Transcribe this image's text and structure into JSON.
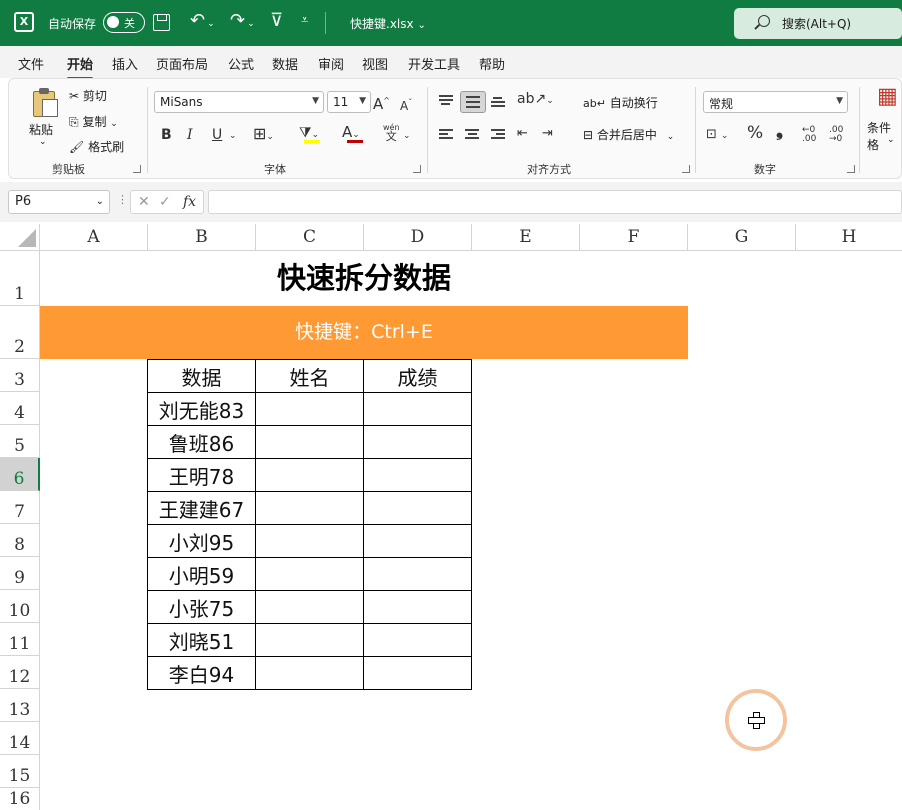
{
  "titlebar": {
    "logo": "X",
    "autosave_label": "自动保存",
    "autosave_state": "关",
    "filename": "快捷键.xlsx",
    "filename_caret": "⌄",
    "search_placeholder": "搜索(Alt+Q)"
  },
  "menu": {
    "tabs": [
      "文件",
      "开始",
      "插入",
      "页面布局",
      "公式",
      "数据",
      "审阅",
      "视图",
      "开发工具",
      "帮助"
    ],
    "active": "开始"
  },
  "ribbon": {
    "clipboard": {
      "paste": "粘贴",
      "cut": "剪切",
      "copy": "复制",
      "format_painter": "格式刷",
      "label": "剪贴板"
    },
    "font": {
      "name": "MiSans",
      "size": "11",
      "grow": "A",
      "shrink": "A",
      "bold": "B",
      "italic": "I",
      "underline": "U",
      "font_color_glyph": "A",
      "phonetic": "wén",
      "phonetic_glyph": "文",
      "label": "字体"
    },
    "alignment": {
      "wrap_text": "自动换行",
      "merge_center": "合并后居中",
      "label": "对齐方式"
    },
    "number": {
      "format": "常规",
      "percent": "%",
      "comma": "❟",
      "label": "数字"
    },
    "styles": {
      "conditional": "条件格"
    },
    "colors": {
      "fill": "#ffff00",
      "font": "#c00000"
    }
  },
  "formula_bar": {
    "name_box": "P6",
    "fx": "fx",
    "cancel": "✕",
    "enter": "✓",
    "content": ""
  },
  "grid": {
    "columns": [
      "A",
      "B",
      "C",
      "D",
      "E",
      "F",
      "G",
      "H"
    ],
    "rows": [
      "1",
      "2",
      "3",
      "4",
      "5",
      "6",
      "7",
      "8",
      "9",
      "10",
      "11",
      "12",
      "13",
      "14",
      "15",
      "16"
    ],
    "active_row": "6",
    "title": "快速拆分数据",
    "banner": "快捷键：Ctrl+E",
    "table": {
      "headers": [
        "数据",
        "姓名",
        "成绩"
      ],
      "rows": [
        [
          "刘无能83",
          "",
          ""
        ],
        [
          "鲁班86",
          "",
          ""
        ],
        [
          "王明78",
          "",
          ""
        ],
        [
          "王建建67",
          "",
          ""
        ],
        [
          "小刘95",
          "",
          ""
        ],
        [
          "小明59",
          "",
          ""
        ],
        [
          "小张75",
          "",
          ""
        ],
        [
          "刘晓51",
          "",
          ""
        ],
        [
          "李白94",
          "",
          ""
        ]
      ]
    },
    "colors": {
      "banner_bg": "#ff9933",
      "accent": "#107c41"
    }
  }
}
